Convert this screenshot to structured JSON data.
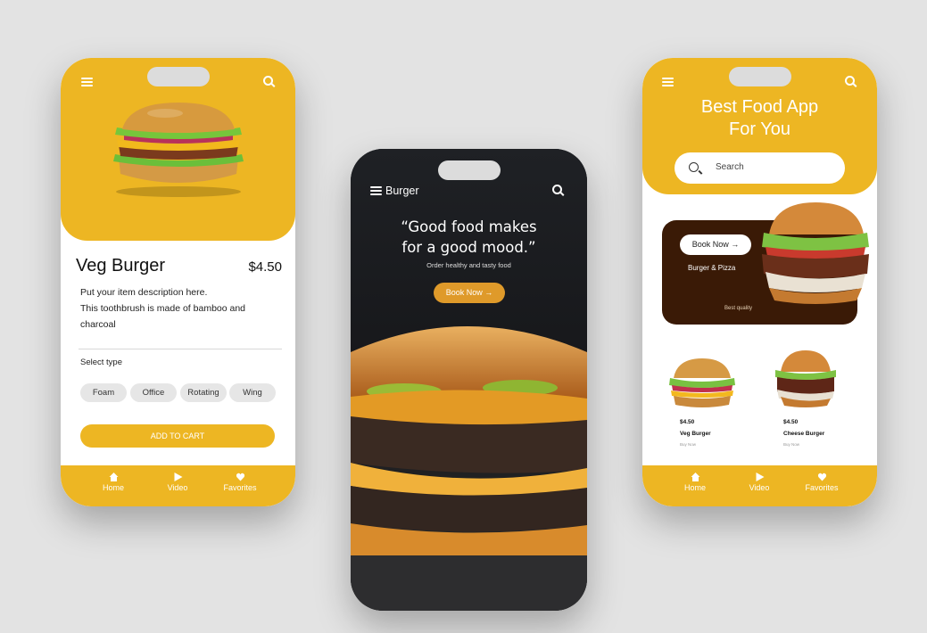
{
  "detail_screen": {
    "product_name": "Veg Burger",
    "price": "$4.50",
    "description_line1": "Put your item description here.",
    "description_line2": "This toothbrush is made of bamboo and",
    "description_line3": "charcoal",
    "select_type_label": "Select type",
    "types": [
      "Foam",
      "Office",
      "Rotating",
      "Wing"
    ],
    "add_to_cart_label": "ADD TO CART",
    "accent_color": "#edb623"
  },
  "splash_screen": {
    "title": "Burger",
    "quote_line1": "“Good food makes",
    "quote_line2": "for a good mood.”",
    "subtitle": "Order healthy and tasty food",
    "book_now_label": "Book Now"
  },
  "home_screen": {
    "heading_line1": "Best Food App",
    "heading_line2": "For You",
    "search_placeholder": "Search",
    "banner": {
      "button_label": "Book Now",
      "caption": "Burger & Pizza",
      "tagline": "Best quality"
    },
    "products": [
      {
        "price": "$4.50",
        "name": "Veg Burger",
        "action": "Buy Now"
      },
      {
        "price": "$4.50",
        "name": "Cheese Burger",
        "action": "Buy Now"
      }
    ]
  },
  "bottom_nav": {
    "items": [
      {
        "label": "Home",
        "icon": "home-icon"
      },
      {
        "label": "Video",
        "icon": "play-icon"
      },
      {
        "label": "Favorites",
        "icon": "heart-icon"
      }
    ]
  }
}
